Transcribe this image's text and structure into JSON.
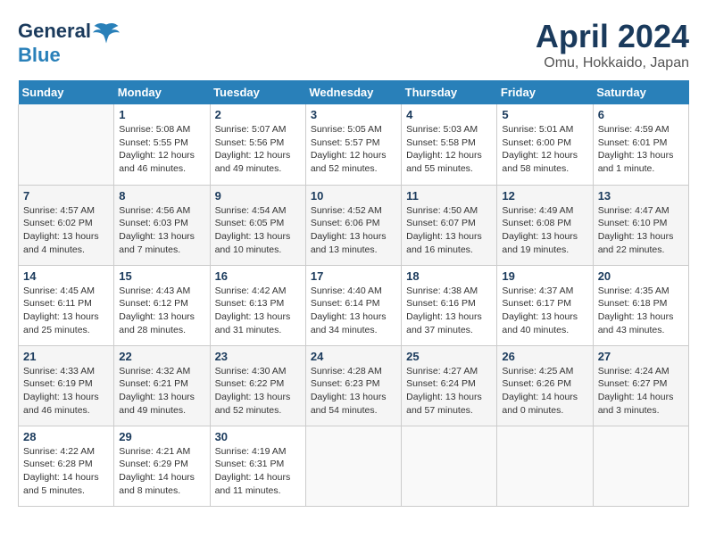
{
  "header": {
    "logo_line1": "General",
    "logo_line2": "Blue",
    "title": "April 2024",
    "subtitle": "Omu, Hokkaido, Japan"
  },
  "columns": [
    "Sunday",
    "Monday",
    "Tuesday",
    "Wednesday",
    "Thursday",
    "Friday",
    "Saturday"
  ],
  "weeks": [
    [
      {
        "day": "",
        "info": ""
      },
      {
        "day": "1",
        "info": "Sunrise: 5:08 AM\nSunset: 5:55 PM\nDaylight: 12 hours\nand 46 minutes."
      },
      {
        "day": "2",
        "info": "Sunrise: 5:07 AM\nSunset: 5:56 PM\nDaylight: 12 hours\nand 49 minutes."
      },
      {
        "day": "3",
        "info": "Sunrise: 5:05 AM\nSunset: 5:57 PM\nDaylight: 12 hours\nand 52 minutes."
      },
      {
        "day": "4",
        "info": "Sunrise: 5:03 AM\nSunset: 5:58 PM\nDaylight: 12 hours\nand 55 minutes."
      },
      {
        "day": "5",
        "info": "Sunrise: 5:01 AM\nSunset: 6:00 PM\nDaylight: 12 hours\nand 58 minutes."
      },
      {
        "day": "6",
        "info": "Sunrise: 4:59 AM\nSunset: 6:01 PM\nDaylight: 13 hours\nand 1 minute."
      }
    ],
    [
      {
        "day": "7",
        "info": "Sunrise: 4:57 AM\nSunset: 6:02 PM\nDaylight: 13 hours\nand 4 minutes."
      },
      {
        "day": "8",
        "info": "Sunrise: 4:56 AM\nSunset: 6:03 PM\nDaylight: 13 hours\nand 7 minutes."
      },
      {
        "day": "9",
        "info": "Sunrise: 4:54 AM\nSunset: 6:05 PM\nDaylight: 13 hours\nand 10 minutes."
      },
      {
        "day": "10",
        "info": "Sunrise: 4:52 AM\nSunset: 6:06 PM\nDaylight: 13 hours\nand 13 minutes."
      },
      {
        "day": "11",
        "info": "Sunrise: 4:50 AM\nSunset: 6:07 PM\nDaylight: 13 hours\nand 16 minutes."
      },
      {
        "day": "12",
        "info": "Sunrise: 4:49 AM\nSunset: 6:08 PM\nDaylight: 13 hours\nand 19 minutes."
      },
      {
        "day": "13",
        "info": "Sunrise: 4:47 AM\nSunset: 6:10 PM\nDaylight: 13 hours\nand 22 minutes."
      }
    ],
    [
      {
        "day": "14",
        "info": "Sunrise: 4:45 AM\nSunset: 6:11 PM\nDaylight: 13 hours\nand 25 minutes."
      },
      {
        "day": "15",
        "info": "Sunrise: 4:43 AM\nSunset: 6:12 PM\nDaylight: 13 hours\nand 28 minutes."
      },
      {
        "day": "16",
        "info": "Sunrise: 4:42 AM\nSunset: 6:13 PM\nDaylight: 13 hours\nand 31 minutes."
      },
      {
        "day": "17",
        "info": "Sunrise: 4:40 AM\nSunset: 6:14 PM\nDaylight: 13 hours\nand 34 minutes."
      },
      {
        "day": "18",
        "info": "Sunrise: 4:38 AM\nSunset: 6:16 PM\nDaylight: 13 hours\nand 37 minutes."
      },
      {
        "day": "19",
        "info": "Sunrise: 4:37 AM\nSunset: 6:17 PM\nDaylight: 13 hours\nand 40 minutes."
      },
      {
        "day": "20",
        "info": "Sunrise: 4:35 AM\nSunset: 6:18 PM\nDaylight: 13 hours\nand 43 minutes."
      }
    ],
    [
      {
        "day": "21",
        "info": "Sunrise: 4:33 AM\nSunset: 6:19 PM\nDaylight: 13 hours\nand 46 minutes."
      },
      {
        "day": "22",
        "info": "Sunrise: 4:32 AM\nSunset: 6:21 PM\nDaylight: 13 hours\nand 49 minutes."
      },
      {
        "day": "23",
        "info": "Sunrise: 4:30 AM\nSunset: 6:22 PM\nDaylight: 13 hours\nand 52 minutes."
      },
      {
        "day": "24",
        "info": "Sunrise: 4:28 AM\nSunset: 6:23 PM\nDaylight: 13 hours\nand 54 minutes."
      },
      {
        "day": "25",
        "info": "Sunrise: 4:27 AM\nSunset: 6:24 PM\nDaylight: 13 hours\nand 57 minutes."
      },
      {
        "day": "26",
        "info": "Sunrise: 4:25 AM\nSunset: 6:26 PM\nDaylight: 14 hours\nand 0 minutes."
      },
      {
        "day": "27",
        "info": "Sunrise: 4:24 AM\nSunset: 6:27 PM\nDaylight: 14 hours\nand 3 minutes."
      }
    ],
    [
      {
        "day": "28",
        "info": "Sunrise: 4:22 AM\nSunset: 6:28 PM\nDaylight: 14 hours\nand 5 minutes."
      },
      {
        "day": "29",
        "info": "Sunrise: 4:21 AM\nSunset: 6:29 PM\nDaylight: 14 hours\nand 8 minutes."
      },
      {
        "day": "30",
        "info": "Sunrise: 4:19 AM\nSunset: 6:31 PM\nDaylight: 14 hours\nand 11 minutes."
      },
      {
        "day": "",
        "info": ""
      },
      {
        "day": "",
        "info": ""
      },
      {
        "day": "",
        "info": ""
      },
      {
        "day": "",
        "info": ""
      }
    ]
  ]
}
